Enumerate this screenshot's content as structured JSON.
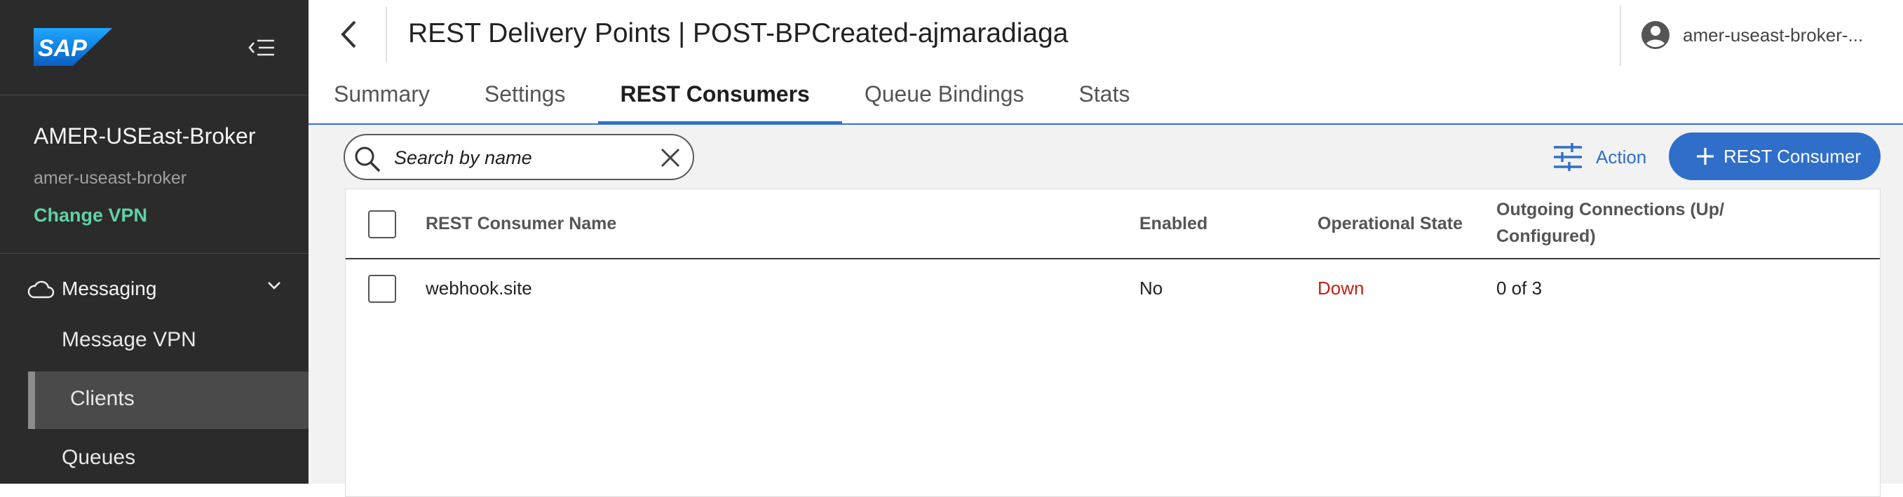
{
  "sidebar": {
    "logo_text": "SAP",
    "broker_name": "AMER-USEast-Broker",
    "broker_id": "amer-useast-broker",
    "change_vpn": "Change VPN",
    "group_label": "Messaging",
    "items": [
      {
        "label": "Message VPN"
      },
      {
        "label": "Clients"
      },
      {
        "label": "Queues"
      }
    ]
  },
  "header": {
    "title": "REST Delivery Points | POST-BPCreated-ajmaradiaga",
    "user": "amer-useast-broker-...",
    "tabs": [
      {
        "label": "Summary"
      },
      {
        "label": "Settings"
      },
      {
        "label": "REST Consumers"
      },
      {
        "label": "Queue Bindings"
      },
      {
        "label": "Stats"
      }
    ]
  },
  "toolbar": {
    "search_placeholder": "Search by name",
    "action_label": "Action",
    "add_label": "REST Consumer"
  },
  "table": {
    "columns": [
      "REST Consumer Name",
      "Enabled",
      "Operational State",
      "Outgoing Connections (Up/\nConfigured)"
    ],
    "rows": [
      {
        "name": "webhook.site",
        "enabled": "No",
        "state": "Down",
        "connections": "0 of 3"
      }
    ]
  },
  "colors": {
    "accent": "#2f6fca",
    "sidebar_bg": "#2b2b2b",
    "change_vpn": "#5fd3a4",
    "status_down": "#c0221a"
  }
}
